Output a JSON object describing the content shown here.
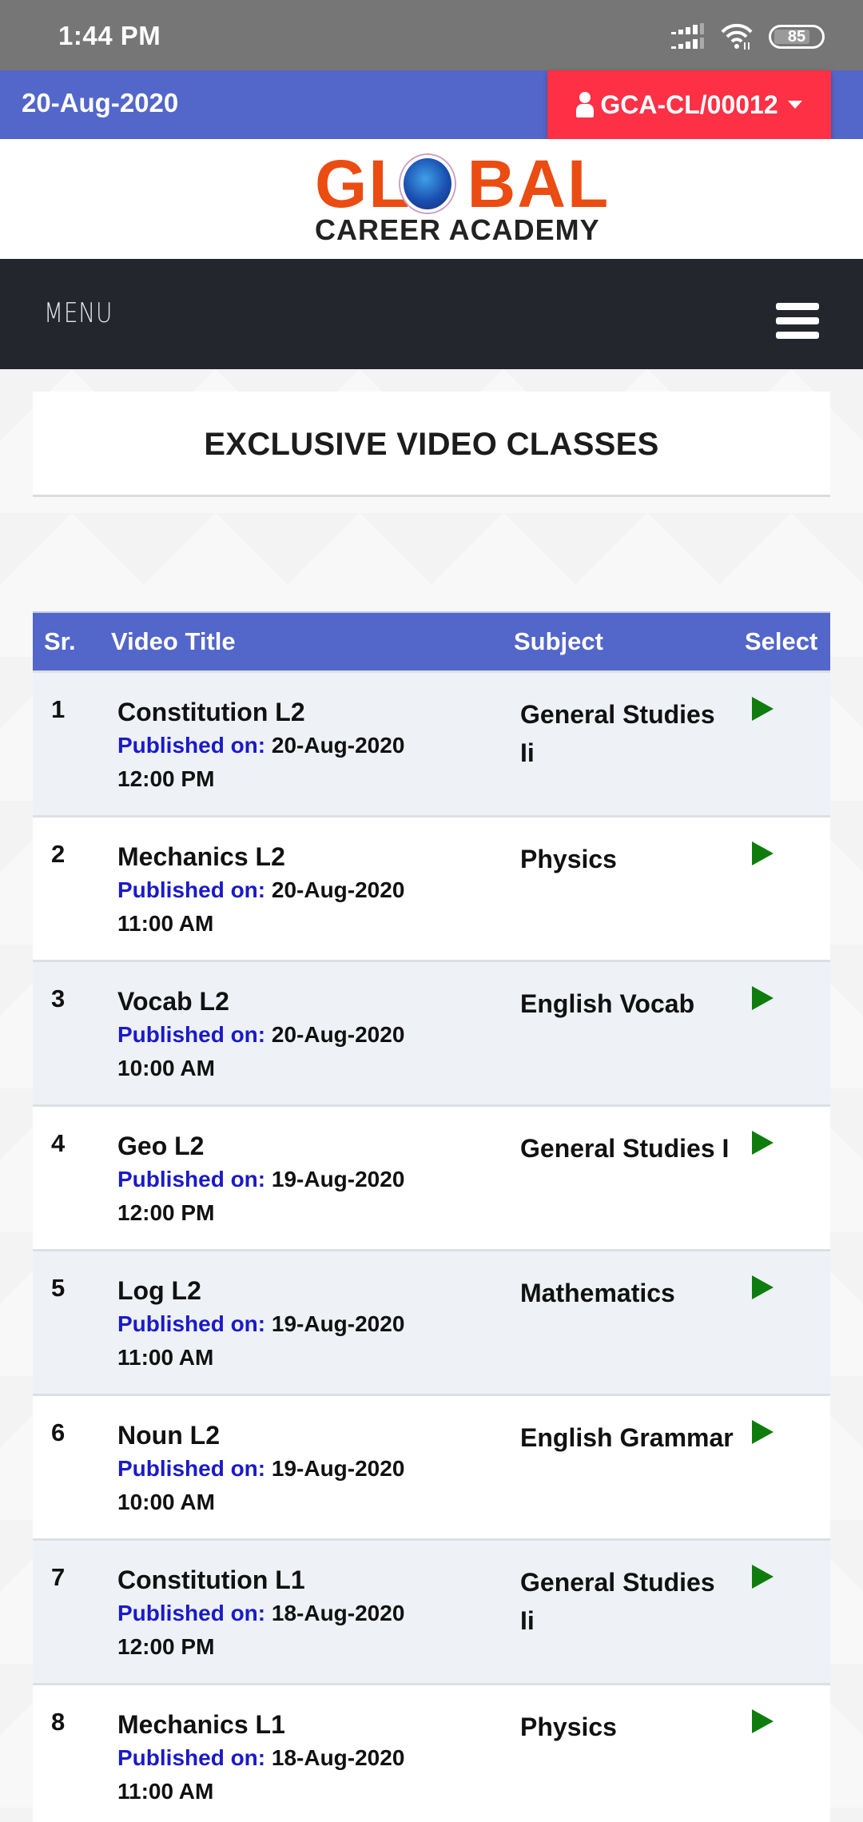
{
  "status_bar": {
    "time": "1:44 PM",
    "battery_level": "85",
    "icons": [
      "signal-icon",
      "wifi-icon",
      "battery-icon"
    ]
  },
  "top_bar": {
    "date": "20-Aug-2020",
    "user_id": "GCA-CL/00012",
    "user_icon": "user-icon",
    "dropdown_icon": "caret-down-icon",
    "colors": {
      "bar": "#5366c9",
      "user_button": "#fd3046"
    }
  },
  "logo": {
    "line1_left": "GL",
    "line1_right": "BAL",
    "line2": "CAREER ACADEMY",
    "colors": {
      "primary": "#ea4c12",
      "secondary": "#222222"
    }
  },
  "nav": {
    "menu_label": "MENU",
    "hamburger_icon": "hamburger-icon"
  },
  "page": {
    "title": "EXCLUSIVE VIDEO CLASSES"
  },
  "table": {
    "headers": {
      "sr": "Sr.",
      "title": "Video Title",
      "subject": "Subject",
      "select": "Select"
    },
    "published_label": "Published on:",
    "rows": [
      {
        "sr": "1",
        "title": "Constitution L2",
        "date": "20-Aug-2020",
        "time": "12:00 PM",
        "subject": "General Studies Ii"
      },
      {
        "sr": "2",
        "title": "Mechanics L2",
        "date": "20-Aug-2020",
        "time": "11:00 AM",
        "subject": "Physics"
      },
      {
        "sr": "3",
        "title": "Vocab L2",
        "date": "20-Aug-2020",
        "time": "10:00 AM",
        "subject": "English Vocab"
      },
      {
        "sr": "4",
        "title": "Geo L2",
        "date": "19-Aug-2020",
        "time": "12:00 PM",
        "subject": "General Studies I"
      },
      {
        "sr": "5",
        "title": "Log L2",
        "date": "19-Aug-2020",
        "time": "11:00 AM",
        "subject": "Mathematics"
      },
      {
        "sr": "6",
        "title": "Noun L2",
        "date": "19-Aug-2020",
        "time": "10:00 AM",
        "subject": "English Grammar"
      },
      {
        "sr": "7",
        "title": "Constitution L1",
        "date": "18-Aug-2020",
        "time": "12:00 PM",
        "subject": "General Studies Ii"
      },
      {
        "sr": "8",
        "title": "Mechanics L1",
        "date": "18-Aug-2020",
        "time": "11:00 AM",
        "subject": "Physics"
      }
    ],
    "play_icon": "play-icon",
    "colors": {
      "header": "#5366c9",
      "published_label": "#1a1ac8",
      "play": "#0e7d0e",
      "odd_row": "#eef1f5"
    }
  }
}
